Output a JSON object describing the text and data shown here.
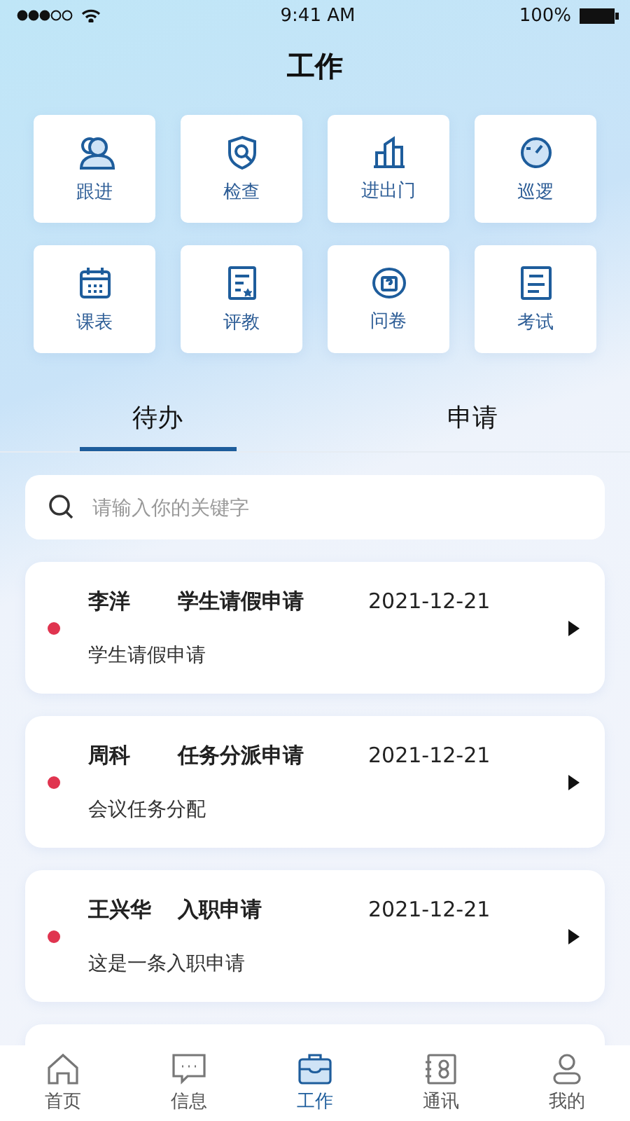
{
  "status_bar": {
    "time": "9:41 AM",
    "battery": "100%"
  },
  "title": "工作",
  "shortcuts": [
    {
      "label": "跟进"
    },
    {
      "label": "检查"
    },
    {
      "label": "进出门"
    },
    {
      "label": "巡逻"
    },
    {
      "label": "课表"
    },
    {
      "label": "评教"
    },
    {
      "label": "问卷"
    },
    {
      "label": "考试"
    }
  ],
  "tabs": [
    {
      "label": "待办",
      "selected": true
    },
    {
      "label": "申请",
      "selected": false
    }
  ],
  "search": {
    "placeholder": "请输入你的关键字"
  },
  "tasks": [
    {
      "name": "李洋",
      "type": "学生请假申请",
      "date": "2021-12-21",
      "note": "学生请假申请",
      "unread": true
    },
    {
      "name": "周科",
      "type": "任务分派申请",
      "date": "2021-12-21",
      "note": "会议任务分配",
      "unread": true
    },
    {
      "name": "王兴华",
      "type": "入职申请",
      "date": "2021-12-21",
      "note": "这是一条入职申请",
      "unread": true
    }
  ],
  "nav": [
    {
      "label": "首页",
      "selected": false
    },
    {
      "label": "信息",
      "selected": false
    },
    {
      "label": "工作",
      "selected": true
    },
    {
      "label": "通讯",
      "selected": false
    },
    {
      "label": "我的",
      "selected": false
    }
  ]
}
